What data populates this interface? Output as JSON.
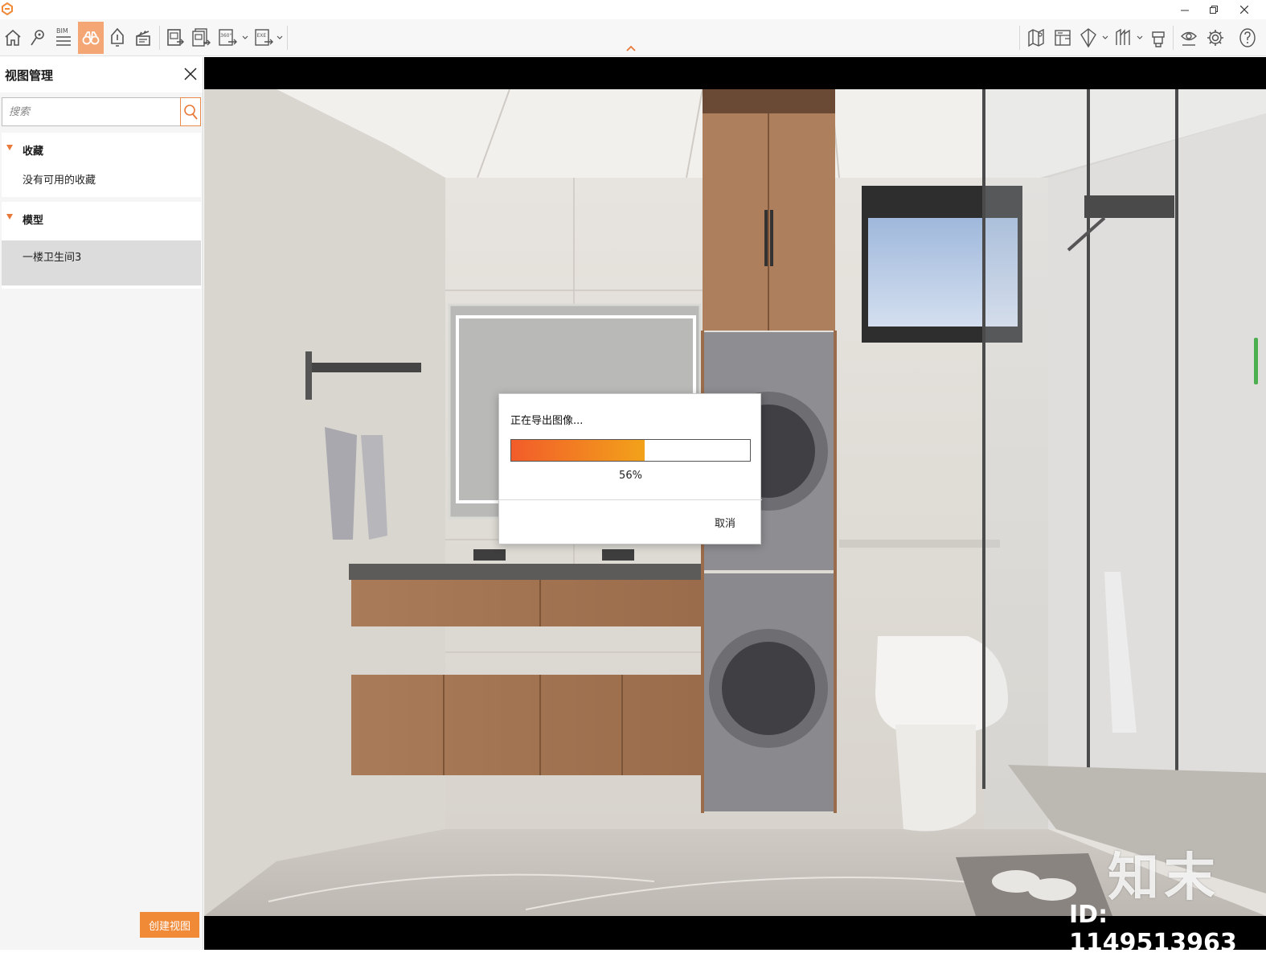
{
  "window": {
    "minimize_icon": "minimize-icon",
    "restore_icon": "restore-icon",
    "close_icon": "close-icon"
  },
  "toolbar": {
    "left_buttons": [
      {
        "name": "home-icon"
      },
      {
        "name": "location-pin-icon"
      },
      {
        "name": "bim-icon",
        "label": "BIM"
      },
      {
        "name": "binoculars-icon",
        "active": true
      },
      {
        "name": "bell-icon"
      },
      {
        "name": "clapperboard-icon"
      },
      {
        "name": "export-image-icon"
      },
      {
        "name": "export-batch-icon"
      },
      {
        "name": "export-360-icon",
        "label": "360°"
      },
      {
        "name": "export-exe-icon",
        "label": "EXE"
      }
    ],
    "right_buttons": [
      {
        "name": "map-icon"
      },
      {
        "name": "floorplan-icon"
      },
      {
        "name": "section-icon"
      },
      {
        "name": "measure-icon"
      },
      {
        "name": "layers-icon"
      },
      {
        "name": "visibility-icon"
      },
      {
        "name": "settings-icon"
      },
      {
        "name": "help-icon"
      }
    ]
  },
  "panel": {
    "title": "视图管理",
    "search_placeholder": "搜索",
    "sections": [
      {
        "label": "收藏",
        "items": [
          "没有可用的收藏"
        ]
      },
      {
        "label": "模型",
        "items": [
          "一楼卫生间3"
        ]
      }
    ],
    "create_button": "创建视图"
  },
  "dialog": {
    "title": "正在导出图像...",
    "progress": 0.56,
    "progress_text": "56%",
    "cancel_label": "取消"
  },
  "watermark": {
    "brand": "知末",
    "id_text": "ID: 1149513963"
  },
  "colors": {
    "accent": "#f08a37",
    "active_tool_bg": "#f4a674",
    "progress_start": "#f25c2a",
    "progress_end": "#f2a21a"
  }
}
